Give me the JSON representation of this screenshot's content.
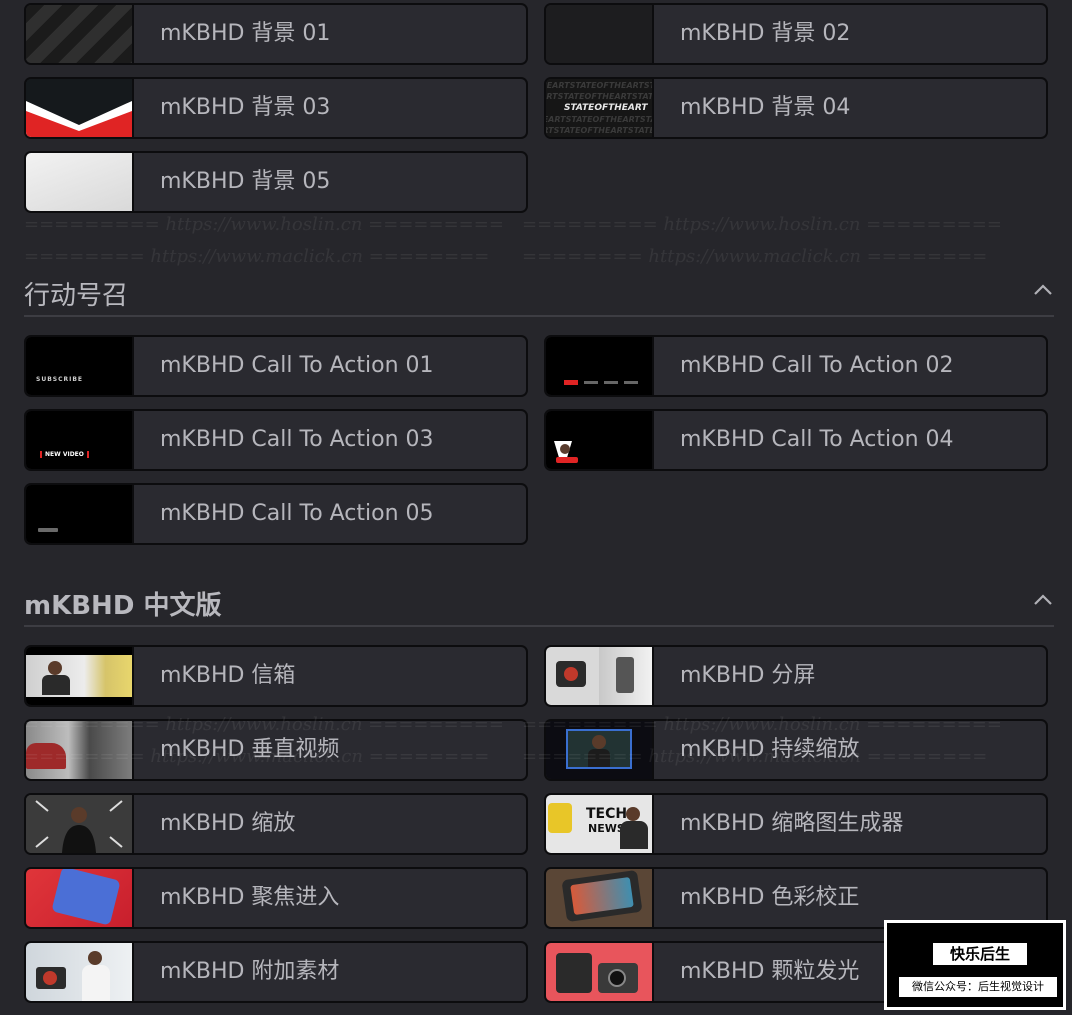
{
  "background_section": {
    "items": [
      {
        "label": "mKBHD 背景 01"
      },
      {
        "label": "mKBHD 背景 02"
      },
      {
        "label": "mKBHD 背景 03"
      },
      {
        "label": "mKBHD 背景 04"
      },
      {
        "label": "mKBHD 背景 05"
      }
    ]
  },
  "cta_section": {
    "title": "行动号召",
    "items": [
      {
        "label": "mKBHD Call To Action 01"
      },
      {
        "label": "mKBHD Call To Action 02"
      },
      {
        "label": "mKBHD Call To Action 03"
      },
      {
        "label": "mKBHD Call To Action 04"
      },
      {
        "label": "mKBHD Call To Action 05"
      }
    ]
  },
  "cn_section": {
    "title": "mKBHD 中文版",
    "items": [
      {
        "label": "mKBHD 信箱"
      },
      {
        "label": "mKBHD 分屏"
      },
      {
        "label": "mKBHD 垂直视频"
      },
      {
        "label": "mKBHD 持续缩放"
      },
      {
        "label": "mKBHD 缩放"
      },
      {
        "label": "mKBHD 缩略图生成器"
      },
      {
        "label": "mKBHD 聚焦进入"
      },
      {
        "label": "mKBHD 色彩校正"
      },
      {
        "label": "mKBHD 附加素材"
      },
      {
        "label": "mKBHD 颗粒发光"
      }
    ]
  },
  "thumb_text": {
    "bg04": "HEARTSTATEOFTHEARTSTATE",
    "bg04_mid": "STATEOFTHEART",
    "cta01": "SUBSCRIBE",
    "cta03": "NEW VIDEO",
    "tech": "TECH",
    "news": "NEWS"
  },
  "watermarks": {
    "hoslin": "========= https://www.hoslin.cn =========",
    "maclick": "======== https://www.maclick.cn ========"
  },
  "badge": {
    "top": "快乐后生",
    "bottom": "微信公众号：后生视觉设计"
  },
  "colors": {
    "page_bg": "#26262b",
    "card_bg": "#2a2a30",
    "text": "#b6b6bc",
    "accent_red": "#e02424"
  }
}
